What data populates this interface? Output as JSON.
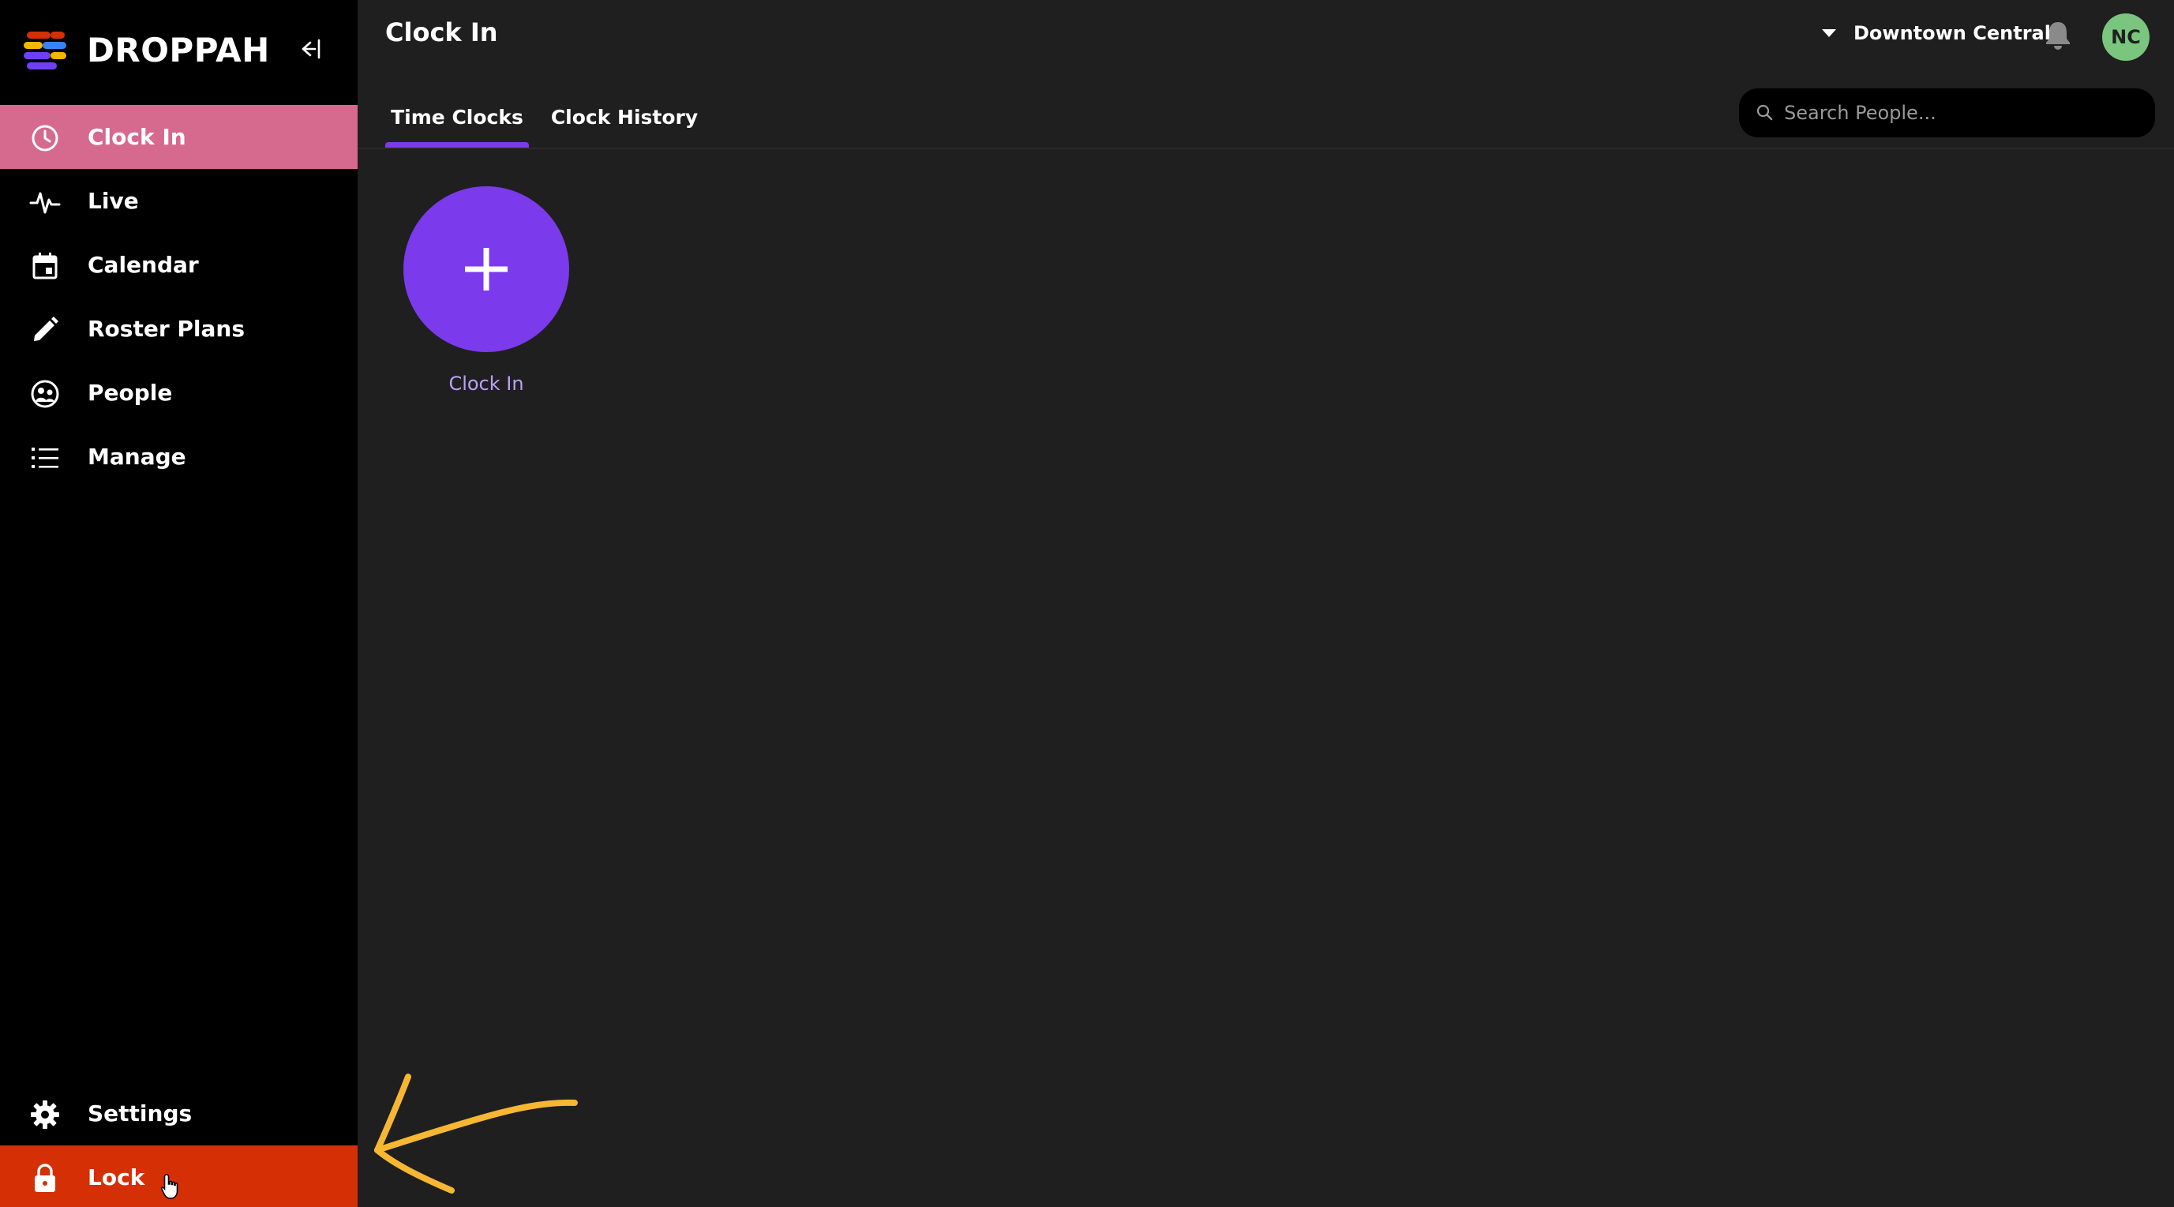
{
  "brand": {
    "name": "DROPPAH",
    "logo_colors": [
      "#d52f06",
      "#f7b500",
      "#6f3ff5",
      "#3b82f6"
    ]
  },
  "colors": {
    "sidebar_bg": "#000000",
    "active_item": "#d6698e",
    "lock_item": "#d52f06",
    "accent": "#7c3aed",
    "avatar_bg": "#7bc67e",
    "annotation_arrow": "#f7b733"
  },
  "sidebar": {
    "collapse_icon": "collapse-left-icon",
    "items": [
      {
        "label": "Clock In",
        "icon": "clock-icon",
        "active": true
      },
      {
        "label": "Live",
        "icon": "pulse-icon",
        "active": false
      },
      {
        "label": "Calendar",
        "icon": "calendar-icon",
        "active": false
      },
      {
        "label": "Roster Plans",
        "icon": "pencil-icon",
        "active": false
      },
      {
        "label": "People",
        "icon": "people-icon",
        "active": false
      },
      {
        "label": "Manage",
        "icon": "list-icon",
        "active": false
      }
    ],
    "bottom": [
      {
        "label": "Settings",
        "icon": "gear-icon"
      },
      {
        "label": "Lock",
        "icon": "lock-icon"
      }
    ]
  },
  "header": {
    "title": "Clock In",
    "location": "Downtown Central",
    "avatar_initials": "NC"
  },
  "tabs": [
    {
      "label": "Time Clocks",
      "active": true
    },
    {
      "label": "Clock History",
      "active": false
    }
  ],
  "search": {
    "placeholder": "Search People...",
    "value": ""
  },
  "content": {
    "add_button_label": "Clock In"
  }
}
